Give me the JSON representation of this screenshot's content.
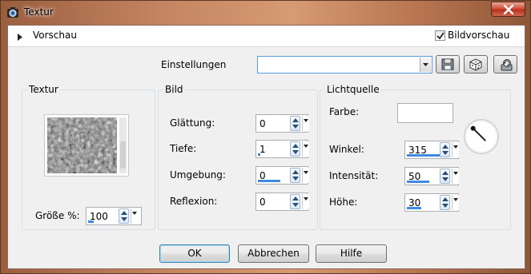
{
  "window": {
    "title": "Textur"
  },
  "preview": {
    "label": "Vorschau",
    "checkbox_label": "Bildvorschau",
    "checked": true
  },
  "settings": {
    "label": "Einstellungen",
    "preset_value": ""
  },
  "textur": {
    "group_title": "Textur",
    "size_label": "Größe %:",
    "size_value": "100",
    "size_fraction": 0.2
  },
  "bild": {
    "group_title": "Bild",
    "rows": [
      {
        "label": "Glättung:",
        "value": "0",
        "fraction": 0
      },
      {
        "label": "Tiefe:",
        "value": "1",
        "fraction": 0.05
      },
      {
        "label": "Umgebung:",
        "value": "0",
        "fraction": 0.5
      },
      {
        "label": "Reflexion:",
        "value": "0",
        "fraction": 0
      }
    ]
  },
  "licht": {
    "group_title": "Lichtquelle",
    "color_label": "Farbe:",
    "color_value": "#ffffff",
    "rows": [
      {
        "label": "Winkel:",
        "value": "315",
        "fraction": 0.875
      },
      {
        "label": "Intensität:",
        "value": "50",
        "fraction": 0.5
      },
      {
        "label": "Höhe:",
        "value": "30",
        "fraction": 0.33
      }
    ]
  },
  "buttons": {
    "ok": "OK",
    "cancel": "Abbrechen",
    "help": "Hilfe"
  },
  "icons": {
    "app": "psp-camera-icon",
    "close": "close-icon",
    "expand": "triangle-right-icon",
    "save": "save-preset-icon",
    "random": "dice-randomize-icon",
    "reset": "reset-default-icon"
  },
  "colors": {
    "accent": "#3c8be0",
    "close": "#c7432b"
  }
}
